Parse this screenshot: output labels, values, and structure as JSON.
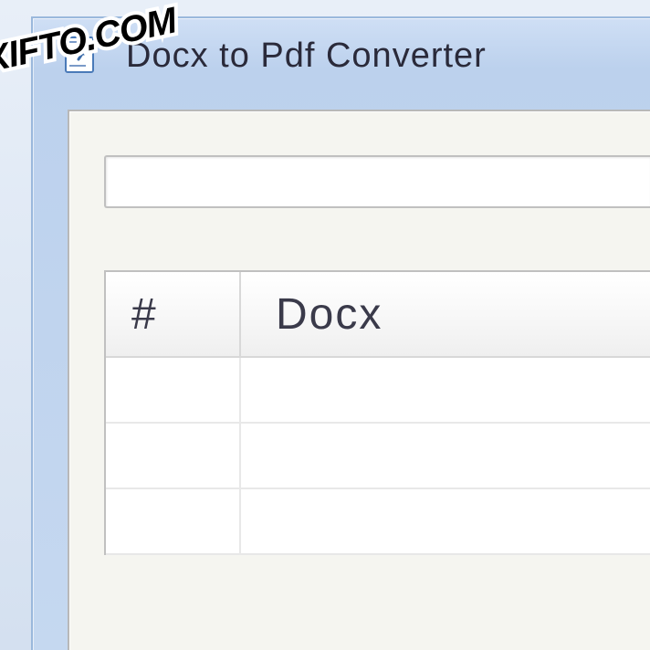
{
  "window": {
    "title": "Docx to Pdf Converter"
  },
  "toolbar": {
    "input_value": ""
  },
  "table": {
    "columns": {
      "number": "#",
      "docx": "Docx"
    },
    "rows": []
  },
  "watermark": {
    "text": "XIFTO.COM"
  }
}
